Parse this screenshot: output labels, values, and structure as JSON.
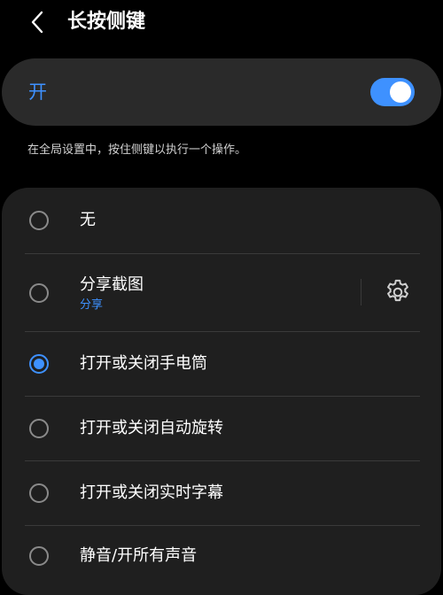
{
  "header": {
    "title": "长按侧键",
    "back_icon": "chevron-left-icon"
  },
  "master_switch": {
    "label": "开",
    "state": "on",
    "accent_color": "#3e91ff"
  },
  "description": "在全局设置中，按住侧键以执行一个操作。",
  "options": [
    {
      "label": "无",
      "selected": false
    },
    {
      "label": "分享截图",
      "sublabel": "分享",
      "selected": false,
      "settings_icon": "gear-icon"
    },
    {
      "label": "打开或关闭手电筒",
      "selected": true
    },
    {
      "label": "打开或关闭自动旋转",
      "selected": false
    },
    {
      "label": "打开或关闭实时字幕",
      "selected": false
    },
    {
      "label": "静音/开所有声音",
      "selected": false
    }
  ]
}
